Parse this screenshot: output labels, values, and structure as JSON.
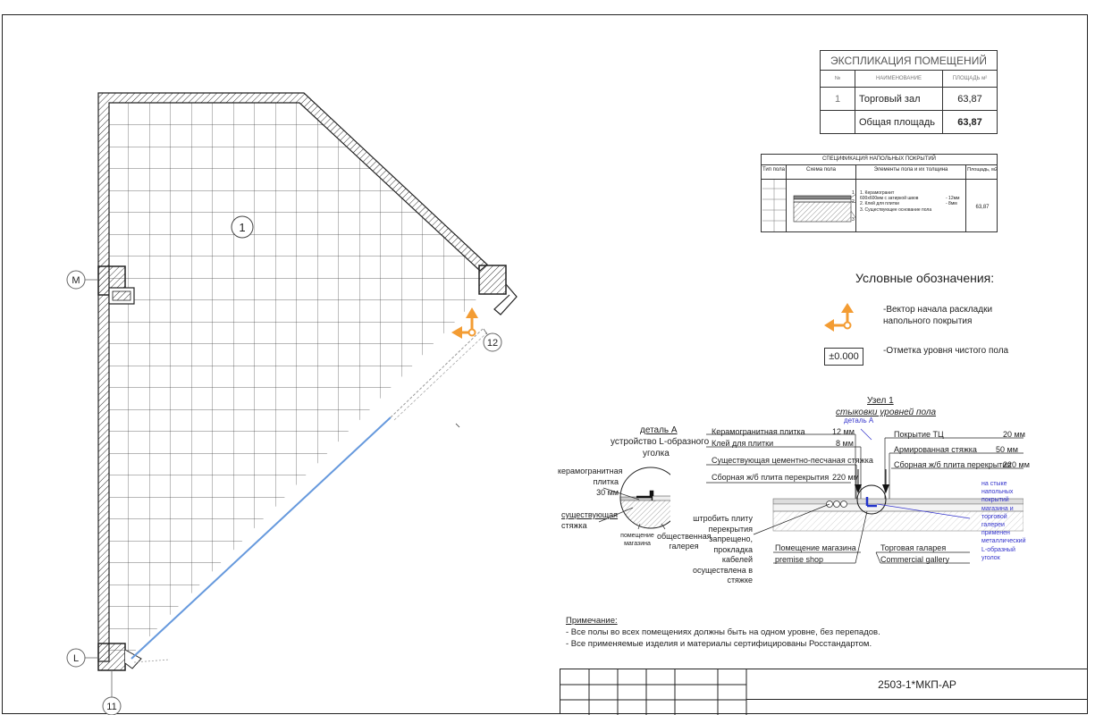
{
  "explication": {
    "title": "ЭКСПЛИКАЦИЯ ПОМЕЩЕНИЙ",
    "col_num": "№",
    "col_name": "НАИМЕНОВАНИЕ",
    "col_area": "ПЛОЩАДЬ м²",
    "rows": [
      {
        "num": "1",
        "name": "Торговый зал",
        "area": "63,87"
      }
    ],
    "total_label": "Общая площадь",
    "total_area": "63,87"
  },
  "floor_spec": {
    "title": "СПЕЦИФИКАЦИЯ НАПОЛЬНЫХ ПОКРЫТИЙ",
    "col_type": "Тип пола",
    "col_scheme": "Схема пола",
    "col_elements": "Элементы пола и их толщина",
    "col_area": "Площадь, м2",
    "elements": [
      "1. Керамогранит",
      "600х600мм  с затиркой швов",
      "2. Клей для плитки",
      "3. Существующее основание пола"
    ],
    "thickness": [
      "- 12мм",
      "- 8мм"
    ],
    "layer_numbers": [
      "1",
      "2",
      "3"
    ],
    "area": "63,87"
  },
  "legend": {
    "title": "Условные обозначения:",
    "vector_text_1": "-Вектор начала раскладки",
    "vector_text_2": "напольного покрытия",
    "level_symbol": "±0.000",
    "level_text": "-Отметка уровня чистого пола"
  },
  "plan": {
    "room_number": "1",
    "axis_M": "М",
    "axis_L": "L",
    "axis_11": "11",
    "axis_12": "12"
  },
  "detail_a": {
    "title": "деталь А",
    "subtitle_1": "устройство L-образного",
    "subtitle_2": "уголка",
    "tile_1": "керамогранитная",
    "tile_2": "плитка",
    "tile_3": "30 мм",
    "screed_1": "существующая",
    "screed_2": "стяжка",
    "shop_1": "помещение",
    "shop_2": "магазина",
    "gallery_1": "общественная",
    "gallery_2": "галерея"
  },
  "node1": {
    "title": "Узел 1",
    "subtitle": "стыковки уровней пола",
    "detail_ref": "деталь А",
    "left_layers": [
      {
        "name": "Керамогранитная плитка",
        "thick": "12 мм"
      },
      {
        "name": "Клей для плитки",
        "thick": "8 мм"
      },
      {
        "name": "Существующая цементно-песчаная стяжка",
        "thick": ""
      },
      {
        "name": "Сборная ж/б плита перекрытия",
        "thick": "220 мм"
      }
    ],
    "right_layers": [
      {
        "name": "Покрытие ТЦ",
        "thick": "20 мм"
      },
      {
        "name": "Армированная стяжка",
        "thick": "50 мм"
      },
      {
        "name": "Сборная ж/б плита перекрытия",
        "thick": "220 мм"
      }
    ],
    "cable_note": [
      "штробить плиту",
      "перекрытия",
      "запрещено,",
      "прокладка",
      "кабелей",
      "осуществлена в",
      "стяжке"
    ],
    "shop_ru": "Помещение магазина",
    "shop_en": "premise shop",
    "gallery_ru": "Торговая галарея",
    "gallery_en": "Commercial gallery",
    "blue_note": [
      "на стыке",
      "напольных",
      "покрытий",
      "магазина и",
      "торговой",
      "галереи",
      "применен",
      "металлический",
      "L-образный",
      "уголок"
    ],
    "blue_color": "#3333cc"
  },
  "notes": {
    "title": "Примечание:",
    "lines": [
      "- Все полы во всех помещениях должны быть на одном уровне, без перепадов.",
      "- Все применяемые изделия и материалы сертифицированы Росстандартом."
    ]
  },
  "stamp": {
    "code": "2503-1*МКП-АР"
  },
  "colors": {
    "vector_arrow": "#f39c33",
    "diagonal_line": "#6699dd",
    "frame": "#222222"
  }
}
